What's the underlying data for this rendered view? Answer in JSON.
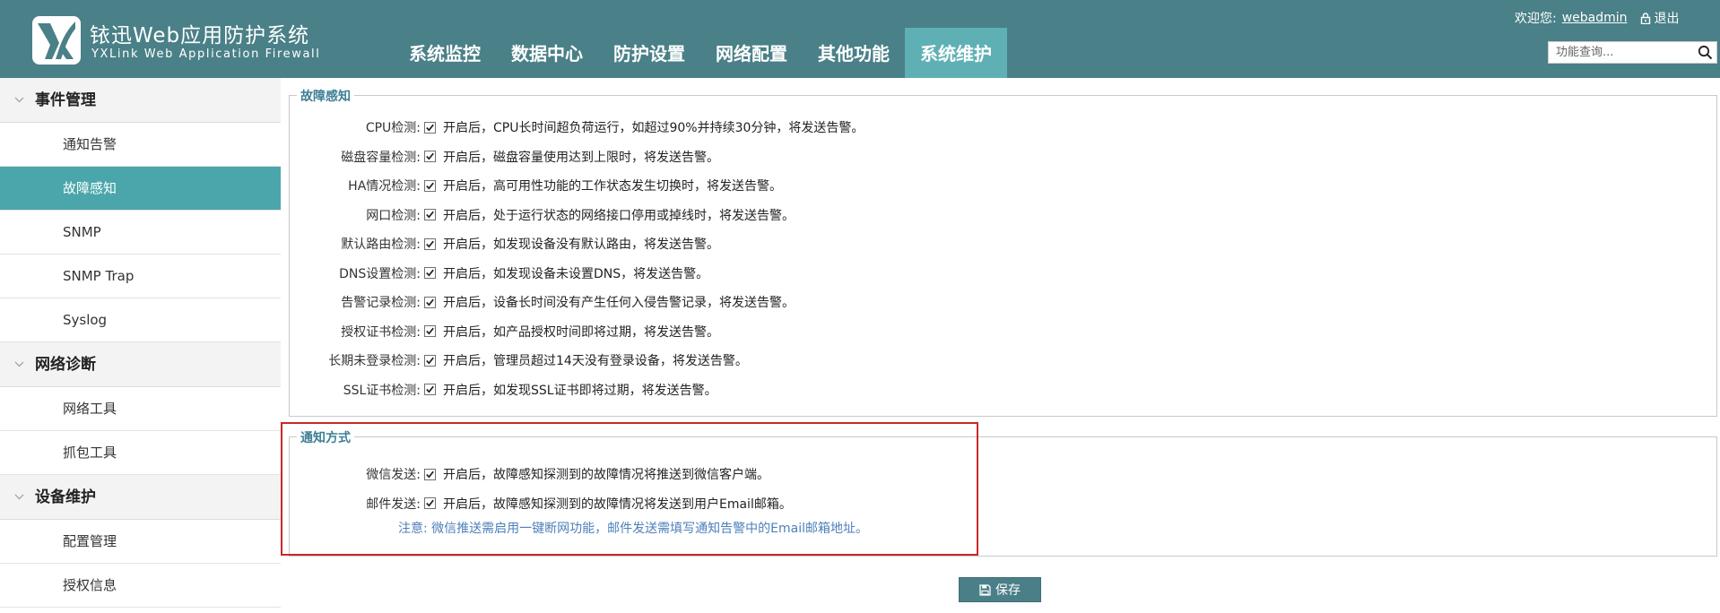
{
  "header": {
    "logo_title": "铱迅Web应用防护系统",
    "logo_subtitle": "YXLink Web Application Firewall",
    "nav": [
      {
        "label": "系统监控",
        "active": false
      },
      {
        "label": "数据中心",
        "active": false
      },
      {
        "label": "防护设置",
        "active": false
      },
      {
        "label": "网络配置",
        "active": false
      },
      {
        "label": "其他功能",
        "active": false
      },
      {
        "label": "系统维护",
        "active": true
      }
    ],
    "welcome_label": "欢迎您:",
    "username": "webadmin",
    "logout_label": "退出",
    "search_placeholder": "功能查询..."
  },
  "sidebar": {
    "groups": [
      {
        "title": "事件管理",
        "items": [
          {
            "label": "通知告警",
            "active": false
          },
          {
            "label": "故障感知",
            "active": true
          },
          {
            "label": "SNMP",
            "active": false
          },
          {
            "label": "SNMP Trap",
            "active": false
          },
          {
            "label": "Syslog",
            "active": false
          }
        ]
      },
      {
        "title": "网络诊断",
        "items": [
          {
            "label": "网络工具",
            "active": false
          },
          {
            "label": "抓包工具",
            "active": false
          }
        ]
      },
      {
        "title": "设备维护",
        "items": [
          {
            "label": "配置管理",
            "active": false
          },
          {
            "label": "授权信息",
            "active": false
          }
        ]
      }
    ]
  },
  "fault": {
    "legend": "故障感知",
    "rows": [
      {
        "label": "CPU检测:",
        "checked": true,
        "desc": "开启后，CPU长时间超负荷运行，如超过90%并持续30分钟，将发送告警。"
      },
      {
        "label": "磁盘容量检测:",
        "checked": true,
        "desc": "开启后，磁盘容量使用达到上限时，将发送告警。"
      },
      {
        "label": "HA情况检测:",
        "checked": true,
        "desc": "开启后，高可用性功能的工作状态发生切换时，将发送告警。"
      },
      {
        "label": "网口检测:",
        "checked": true,
        "desc": "开启后，处于运行状态的网络接口停用或掉线时，将发送告警。"
      },
      {
        "label": "默认路由检测:",
        "checked": true,
        "desc": "开启后，如发现设备没有默认路由，将发送告警。"
      },
      {
        "label": "DNS设置检测:",
        "checked": true,
        "desc": "开启后，如发现设备未设置DNS，将发送告警。"
      },
      {
        "label": "告警记录检测:",
        "checked": true,
        "desc": "开启后，设备长时间没有产生任何入侵告警记录，将发送告警。"
      },
      {
        "label": "授权证书检测:",
        "checked": true,
        "desc": "开启后，如产品授权时间即将过期，将发送告警。"
      },
      {
        "label": "长期未登录检测:",
        "checked": true,
        "desc": "开启后，管理员超过14天没有登录设备，将发送告警。"
      },
      {
        "label": "SSL证书检测:",
        "checked": true,
        "desc": "开启后，如发现SSL证书即将过期，将发送告警。"
      }
    ]
  },
  "notify": {
    "legend": "通知方式",
    "rows": [
      {
        "label": "微信发送:",
        "checked": true,
        "desc": "开启后，故障感知探测到的故障情况将推送到微信客户端。"
      },
      {
        "label": "邮件发送:",
        "checked": true,
        "desc": "开启后，故障感知探测到的故障情况将发送到用户Email邮箱。"
      }
    ],
    "note": "注意: 微信推送需启用一键断网功能，邮件发送需填写通知告警中的Email邮箱地址。"
  },
  "save_label": "保存",
  "colors": {
    "header_bg": "#4a8087",
    "nav_active": "#5fb0b4",
    "sidebar_active": "#4aa6ab",
    "highlight_border": "#c8282c",
    "legend_text": "#3e7f95",
    "note_text": "#4d7fba"
  }
}
